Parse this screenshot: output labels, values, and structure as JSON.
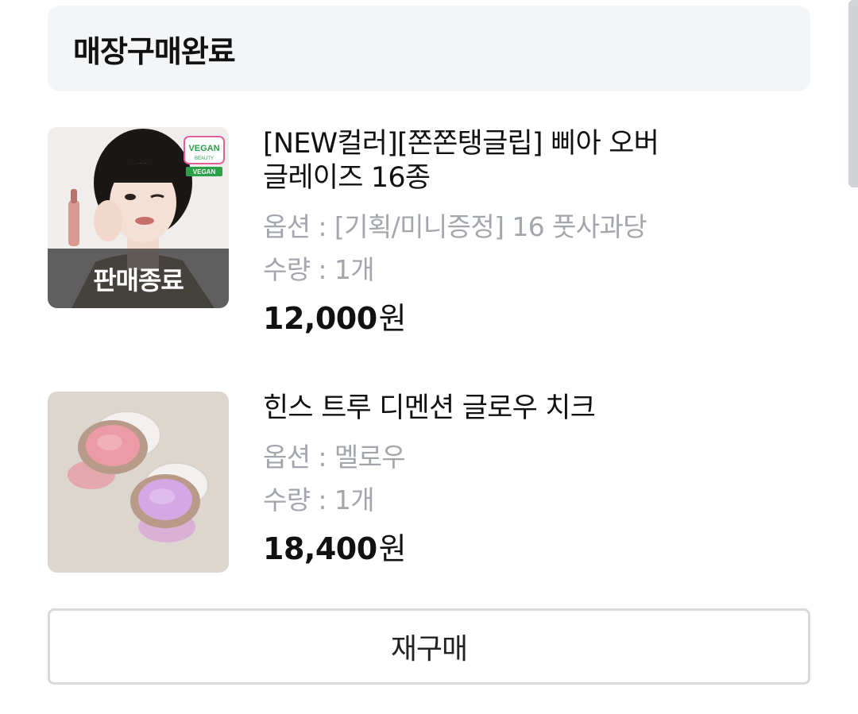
{
  "order": {
    "status_title": "매장구매완료"
  },
  "products": [
    {
      "name": "[NEW컬러][쫀쫀탱글립] 삐아 오버\n글레이즈 16종",
      "option": "옵션 : [기획/미니증정] 16 풋사과당",
      "quantity": "수량 : 1개",
      "price": "12,000",
      "currency": "원",
      "badge": "판매종료",
      "image_badges": [
        "VEGAN",
        "BEAUTY",
        "VEGAN"
      ]
    },
    {
      "name": "힌스 트루 디멘션 글로우 치크",
      "option": "옵션 : 멜로우",
      "quantity": "수량 : 1개",
      "price": "18,400",
      "currency": "원"
    }
  ],
  "actions": {
    "reorder_label": "재구매"
  },
  "colors": {
    "header_bg": "#f4f5f7",
    "muted_text": "#a3a6ac",
    "border": "#d8d9dc"
  }
}
